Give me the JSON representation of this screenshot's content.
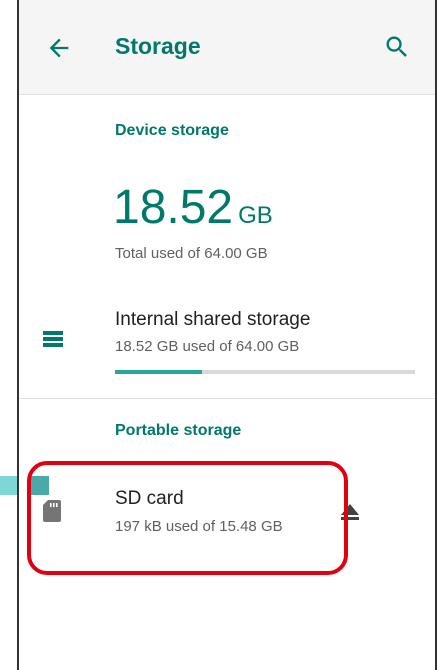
{
  "appbar": {
    "back_icon": "arrow-back-icon",
    "title": "Storage",
    "search_icon": "search-icon"
  },
  "device_storage": {
    "section_label": "Device storage",
    "used_value": "18.52",
    "used_unit": "GB",
    "total_label": "Total used of 64.00 GB",
    "internal": {
      "icon": "storage-list-icon",
      "title": "Internal shared storage",
      "subtitle": "18.52 GB used of 64.00 GB",
      "progress_fraction": 0.2894
    }
  },
  "portable_storage": {
    "section_label": "Portable storage",
    "sd_card": {
      "icon": "sd-card-icon",
      "title": "SD card",
      "subtitle": "197 kB used of 15.48 GB",
      "eject_icon": "eject-icon"
    }
  },
  "colors": {
    "accent": "#00796b",
    "progress": "#26a69a",
    "highlight": "#e10010"
  }
}
